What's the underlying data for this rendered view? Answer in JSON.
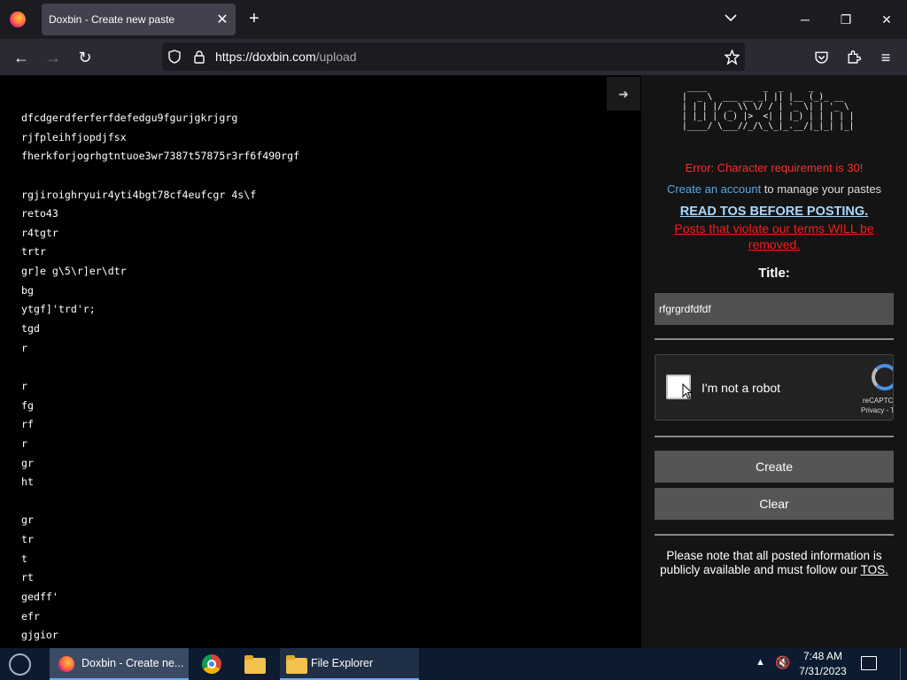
{
  "browser": {
    "tab_title": "Doxbin - Create new paste",
    "tab_close": "✕",
    "new_tab": "+",
    "url_host": "https://doxbin.com",
    "url_path": "/upload",
    "window_minimize": "─",
    "window_restore": "❐",
    "window_close": "✕",
    "nav_back": "←",
    "nav_forward": "→",
    "nav_reload": "↻",
    "menu": "≡"
  },
  "paste": {
    "lines": [
      "dfcdgerdferferfdefedgu9fgurjgkrjgrg",
      "rjfpleihfjopdjfsx",
      "fherkforjogrhgtntuoe3wr7387t57875r3rf6f490rgf",
      "",
      "rgjiroighryuir4yti4bgt78cf4eufcgr 4s\\f",
      "reto43",
      "r4tgtr",
      "trtr",
      "gr]e g\\5\\r]er\\dtr",
      "bg",
      "ytgf]'trd'r;",
      "tgd",
      "r",
      "",
      "r",
      "fg",
      "rf",
      "r",
      "gr",
      "ht",
      "",
      "gr",
      "tr",
      "t",
      "rt",
      "gedff'",
      "efr",
      "gjgior"
    ],
    "collapse_icon": "➜"
  },
  "sidebar": {
    "logo_ascii": " ____           _  _     _\n|  _ \\  ___ __ _| || |__ (_)_ __\n| | | |/ _ \\\\ \\/ / | '_ \\| | '_ \\\n| |_| | (_) |>  <| | |_) | | | | |\n|____/ \\___//_/\\_\\_|_.__/|_|_| |_|",
    "error": "Error: Character requirement is 30!",
    "account_link": "Create an account",
    "account_rest": " to manage your pastes",
    "tos_heading": "READ TOS BEFORE POSTING.",
    "tos_warning": "Posts that violate our terms WILL be removed.",
    "title_label": "Title:",
    "title_value": "rfgrgrdfdfdf",
    "captcha_label": "I'm not a robot",
    "captcha_brand": "reCAPTC",
    "captcha_links": "Privacy - T",
    "create_button": "Create",
    "clear_button": "Clear",
    "note_text": "Please note that all posted information is publicly available and must follow our ",
    "note_tos": "TOS."
  },
  "taskbar": {
    "firefox_label": "Doxbin - Create ne...",
    "explorer_label": "File Explorer",
    "tray_up": "▲",
    "volume": "🔇",
    "time": "7:48 AM",
    "date": "7/31/2023"
  }
}
